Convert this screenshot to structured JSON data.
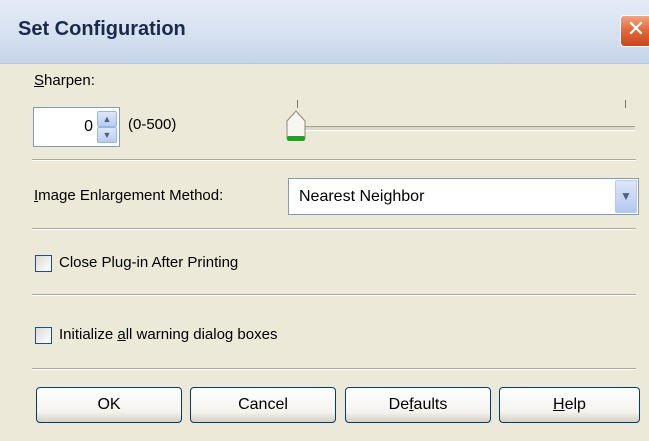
{
  "window": {
    "title": "Set Configuration",
    "close_glyph": "✕",
    "accent_color": "#e36a3d"
  },
  "sharpen": {
    "label_mnemonic": "S",
    "label_rest": "harpen:",
    "value": "0",
    "range_text": "(0-500)",
    "min": 0,
    "max": 500,
    "slider_fraction": 0.0
  },
  "enlargement": {
    "label_mnemonic": "I",
    "label_rest": "mage Enlargement Method:",
    "selected": "Nearest Neighbor"
  },
  "close_plugin": {
    "label": "Close Plug-in After Printing",
    "checked": false
  },
  "init_warnings": {
    "label_pre": "Initialize ",
    "label_mnemonic": "a",
    "label_post": "ll warning dialog boxes",
    "checked": false
  },
  "buttons": {
    "ok": "OK",
    "cancel": "Cancel",
    "defaults_pre": "De",
    "defaults_mnemonic": "f",
    "defaults_post": "aults",
    "help_mnemonic": "H",
    "help_post": "elp"
  },
  "icons": {
    "close": "close-icon",
    "spin_up": "arrow-up-icon",
    "spin_down": "arrow-down-icon",
    "combo": "chevron-down-icon"
  }
}
